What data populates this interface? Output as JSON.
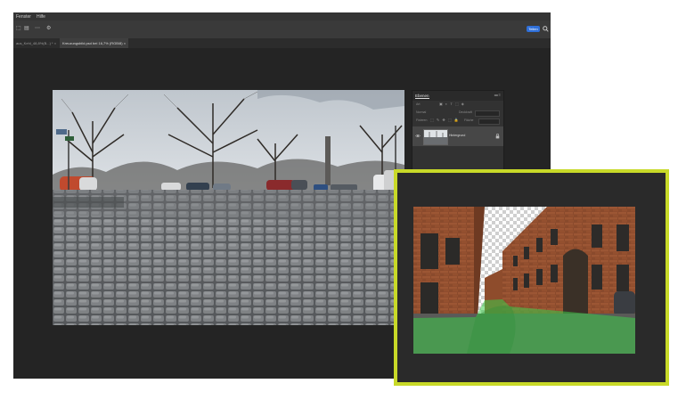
{
  "menu": {
    "items": [
      "Fenster",
      "Hilfe"
    ]
  },
  "optionsbar": {
    "tools": [
      "⬚",
      "▤",
      "⋯",
      "⚙"
    ],
    "share_label": "Teilen"
  },
  "tabs": [
    {
      "label": "aus_Kehl_48,8%(B...) *  ×",
      "active": false
    },
    {
      "label": "Kreuzungsbild.psd bei 16,7% (RGB/8)  ×",
      "active": true
    }
  ],
  "layers_panel": {
    "title": "Ebenen",
    "controls": "◂◂  ≡",
    "kind_label": "Art",
    "mode_label": "Normal",
    "opacity_label": "Deckkraft",
    "lock_label": "Fixieren",
    "fill_label": "Fläche",
    "filter_glyphs": "▣ ◐ T ⬚ ◈",
    "lock_glyphs": "⬚ ✎ ✥ ⬚ 🔒",
    "layer": {
      "name": "Hintergrund",
      "visible": true
    }
  },
  "colors": {
    "accent_frame": "#c8d928",
    "share_button": "#2f6fd8",
    "selection_overlay": "#3ecc4a"
  }
}
